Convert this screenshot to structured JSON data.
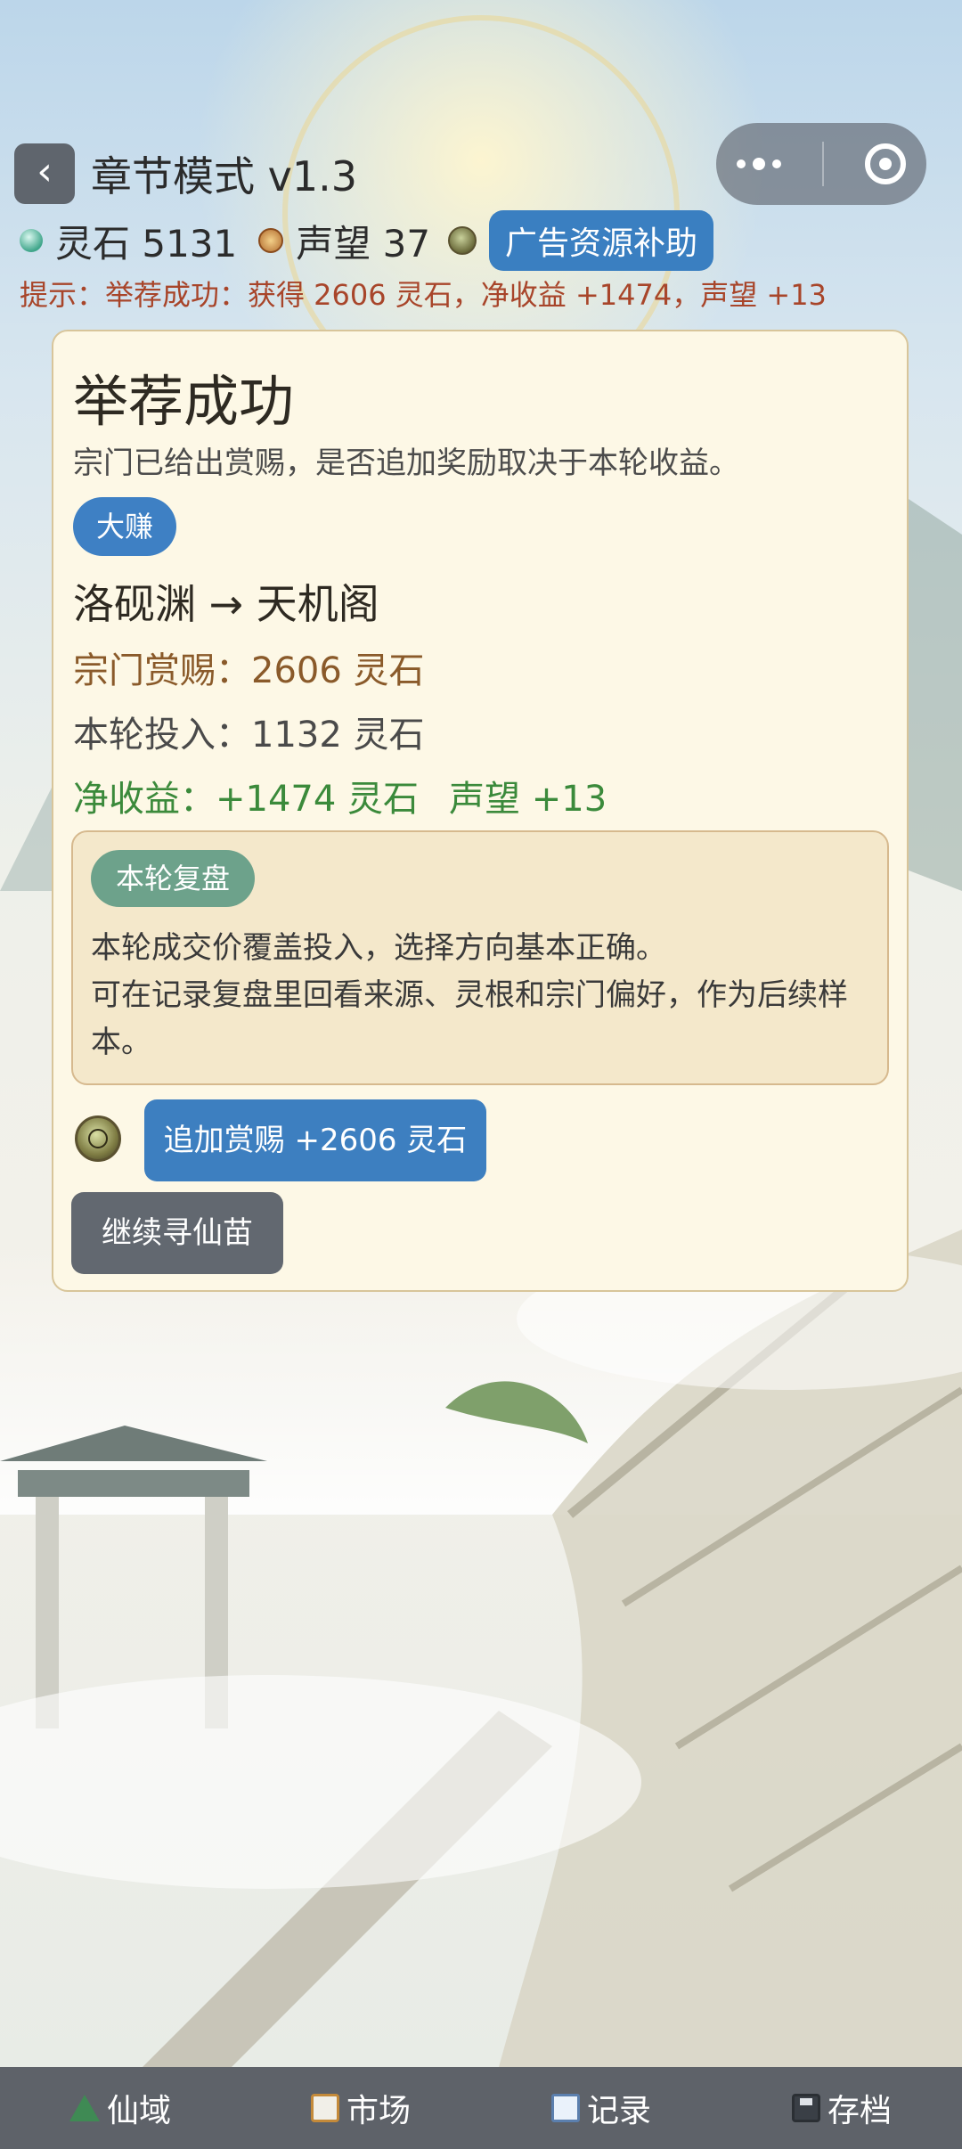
{
  "header": {
    "back_icon": "‹",
    "title": "章节模式 v1.3"
  },
  "stats": {
    "spirit_stone_label": "灵石 5131",
    "reputation_label": "声望 37",
    "ad_button": "广告资源补助"
  },
  "hint": "提示：举荐成功：获得 2606 灵石，净收益 +1474，声望 +13",
  "card": {
    "title": "举荐成功",
    "desc": "宗门已给出赏赐，是否追加奖励取决于本轮收益。",
    "tag": "大赚",
    "route": "洛砚渊 → 天机阁",
    "reward": "宗门赏赐：2606 灵石",
    "investment": "本轮投入：1132 灵石",
    "profit": "净收益：+1474 灵石",
    "reputation_gain": "声望 +13",
    "review": {
      "tag": "本轮复盘",
      "line1": "本轮成交价覆盖投入，选择方向基本正确。",
      "line2": "可在记录复盘里回看来源、灵根和宗门偏好，作为后续样本。"
    },
    "bonus_button": "追加赏赐 +2606 灵石",
    "continue_button": "继续寻仙苗"
  },
  "bottom_nav": [
    {
      "label": "仙域",
      "icon": "mountain-icon"
    },
    {
      "label": "市场",
      "icon": "clipboard-icon"
    },
    {
      "label": "记录",
      "icon": "book-icon"
    },
    {
      "label": "存档",
      "icon": "floppy-disk-icon"
    }
  ]
}
